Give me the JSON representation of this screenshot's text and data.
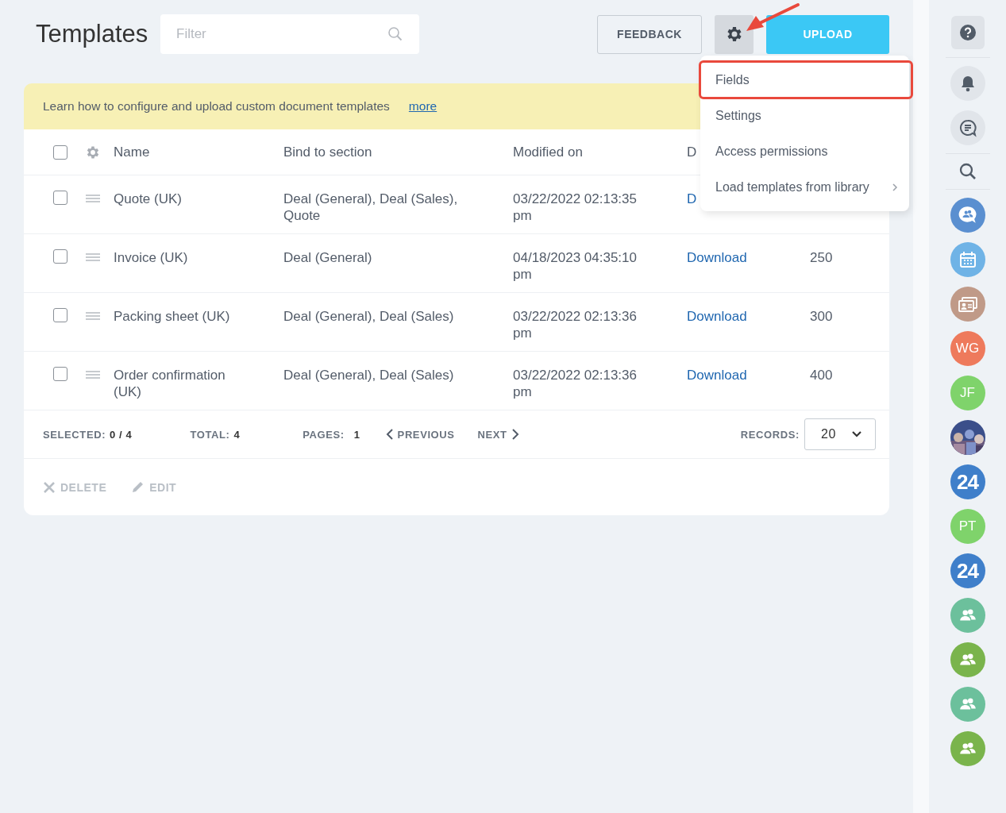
{
  "header": {
    "title": "Templates",
    "filter": {
      "placeholder": "Filter"
    },
    "buttons": [
      {
        "kind": "text",
        "label": "FEEDBACK"
      },
      {
        "kind": "gear"
      },
      {
        "kind": "primary",
        "label": "UPLOAD"
      }
    ]
  },
  "banner": {
    "text": "Learn how to configure and upload custom document templates",
    "link": "more"
  },
  "table": {
    "columns": [
      "Name",
      "Bind to section",
      "Modified on",
      "D"
    ],
    "rows": [
      {
        "checked": false,
        "name": "Quote (UK)",
        "bind_to_section": "Deal (General), Deal (Sales), Quote",
        "modified_on": "03/22/2022 02:13:35 pm",
        "column_4": "D"
      },
      {
        "checked": false,
        "name": "Invoice (UK)",
        "bind_to_section": "Deal (General)",
        "modified_on": "04/18/2023 04:35:10 pm",
        "column_4": "Download",
        "column_5": "250"
      },
      {
        "checked": false,
        "name": "Packing sheet (UK)",
        "bind_to_section": "Deal (General), Deal (Sales)",
        "modified_on": "03/22/2022 02:13:36 pm",
        "column_4": "Download",
        "column_5": "300"
      },
      {
        "checked": false,
        "name": "Order confirmation (UK)",
        "bind_to_section": "Deal (General), Deal (Sales)",
        "modified_on": "03/22/2022 02:13:36 pm",
        "column_4": "Download",
        "column_5": "400"
      }
    ],
    "header_checked": false
  },
  "footer": {
    "selected_label": "SELECTED:",
    "selected": "0 / 4",
    "total_label": "TOTAL:",
    "total": "4",
    "pages_label": "PAGES:",
    "pages": "1",
    "previous": "PREVIOUS",
    "next": "NEXT",
    "records_label": "RECORDS:",
    "records": "20"
  },
  "actions": [
    {
      "kind": "delete",
      "label": "DELETE",
      "disabled": true
    },
    {
      "kind": "edit",
      "label": "EDIT",
      "disabled": true
    }
  ],
  "menu": {
    "items": [
      {
        "label": "Fields",
        "highlighted": true,
        "has_submenu": false
      },
      {
        "label": "Settings",
        "highlighted": false,
        "has_submenu": false
      },
      {
        "label": "Access permissions",
        "highlighted": false,
        "has_submenu": false
      },
      {
        "label": "Load templates from library",
        "highlighted": false,
        "has_submenu": true
      }
    ]
  },
  "sidebar": {
    "items": [
      {
        "kind": "help"
      },
      {
        "kind": "bell"
      },
      {
        "kind": "chat"
      },
      {
        "kind": "search"
      },
      {
        "kind": "group-chat",
        "color": "#5a8fd0"
      },
      {
        "kind": "calendar",
        "color": "#6fb3e6"
      },
      {
        "kind": "contacts",
        "color": "#c09a88"
      },
      {
        "kind": "initials",
        "text": "WG",
        "color": "#ee7a5c"
      },
      {
        "kind": "initials",
        "text": "JF",
        "color": "#7fd36b"
      },
      {
        "kind": "picture"
      },
      {
        "kind": "number",
        "text": "24",
        "color": "#3f7fca"
      },
      {
        "kind": "initials",
        "text": "PT",
        "color": "#7fd36b"
      },
      {
        "kind": "number",
        "text": "24",
        "color": "#3f7fca"
      },
      {
        "kind": "group",
        "color": "#6cc09c"
      },
      {
        "kind": "group",
        "color": "#7ab44c"
      },
      {
        "kind": "group",
        "color": "#6cc09c"
      },
      {
        "kind": "group",
        "color": "#7ab44c"
      }
    ]
  }
}
